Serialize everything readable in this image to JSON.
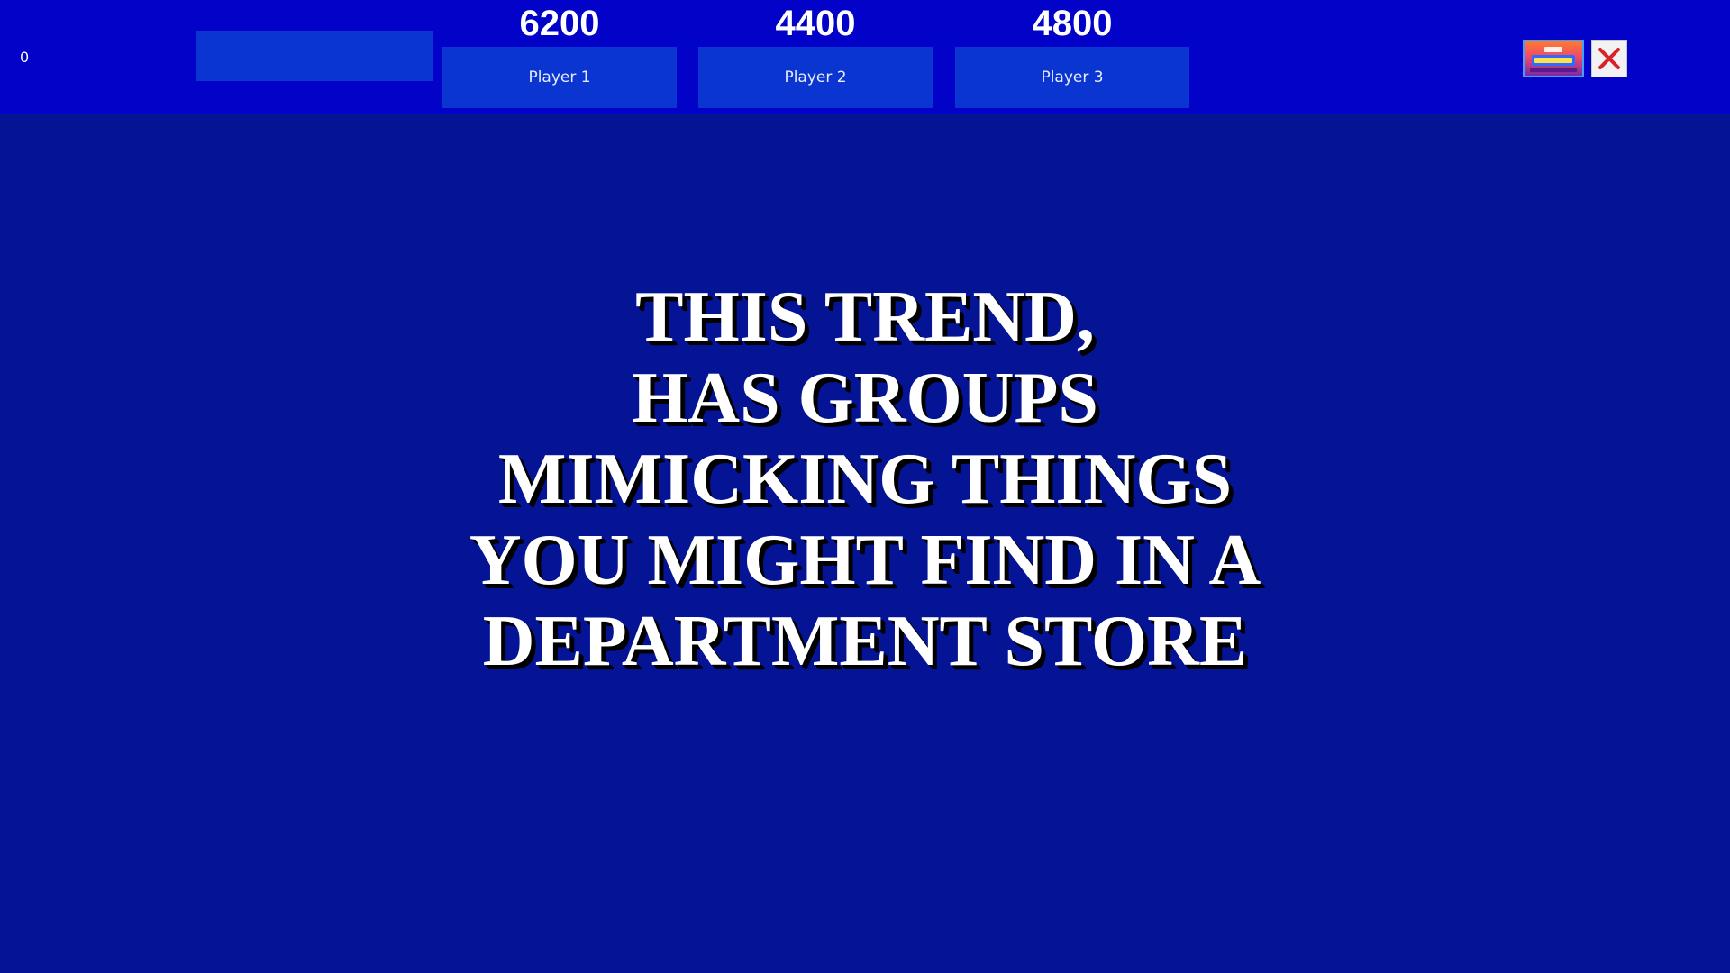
{
  "header": {
    "counter": "0"
  },
  "players": [
    {
      "score": "6200",
      "name": "Player 1"
    },
    {
      "score": "4400",
      "name": "Player 2"
    },
    {
      "score": "4800",
      "name": "Player 3"
    }
  ],
  "controls": {
    "final_button_icon": "final-jeopardy-logo-icon",
    "close_icon": "close-x-icon",
    "close_color": "#d8232a"
  },
  "clue": {
    "lines": [
      "THIS TREND,",
      "HAS GROUPS",
      "MIMICKING THINGS",
      "YOU MIGHT FIND IN A",
      "DEPARTMENT STORE"
    ]
  },
  "colors": {
    "background": "#041494",
    "topbar": "#0202c8",
    "button": "#0a35d0"
  }
}
